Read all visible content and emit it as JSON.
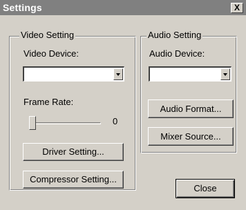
{
  "window": {
    "title": "Settings",
    "close_glyph": "X"
  },
  "video": {
    "group_title": "Video Setting",
    "device_label": "Video Device:",
    "device_value": "",
    "frame_rate_label": "Frame Rate:",
    "frame_rate_value": "0",
    "frame_rate_level": 0,
    "driver_button": "Driver Setting...",
    "compressor_button": "Compressor Setting..."
  },
  "audio": {
    "group_title": "Audio Setting",
    "device_label": "Audio Device:",
    "device_value": "",
    "format_button": "Audio Format...",
    "mixer_button": "Mixer Source..."
  },
  "actions": {
    "close_button": "Close"
  },
  "icons": {
    "dropdown": "chevron-down-icon",
    "close": "close-icon"
  },
  "colors": {
    "titlebar": "#808080",
    "face": "#d4d0c8"
  }
}
